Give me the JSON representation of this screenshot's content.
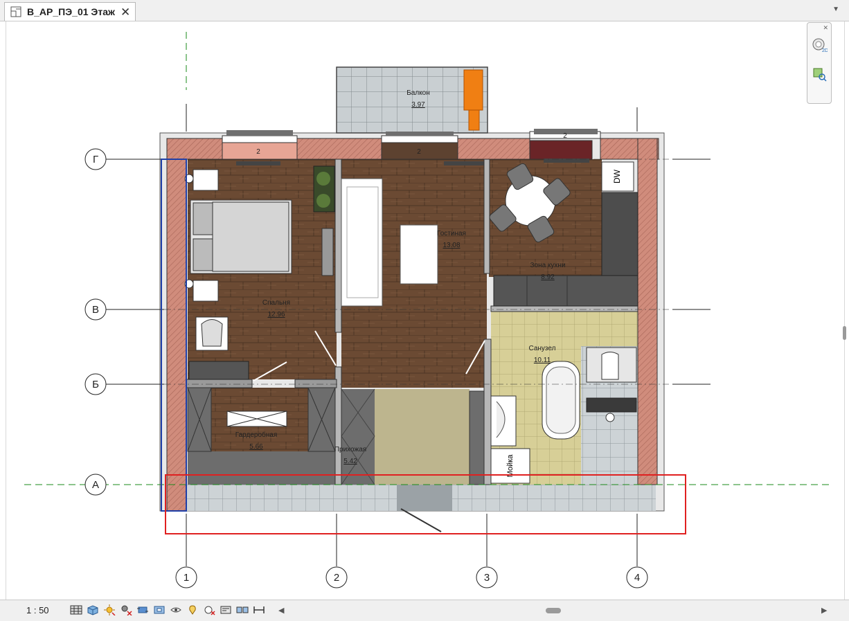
{
  "tab": {
    "title": "В_АР_ПЭ_01 Этаж",
    "close": "✕",
    "dropdown": "▼"
  },
  "rooms": [
    {
      "name": "Балкон",
      "area": "3.97"
    },
    {
      "name": "Гостиная",
      "area": "13.08"
    },
    {
      "name": "Зона кухни",
      "area": "8.92"
    },
    {
      "name": "Спальня",
      "area": "12.96"
    },
    {
      "name": "Санузел",
      "area": "10.11"
    },
    {
      "name": "Гардеробная",
      "area": "5.66"
    },
    {
      "name": "Прихожая",
      "area": "5.42"
    }
  ],
  "labels": {
    "dishwasher": "DW",
    "sink": "Мойка",
    "window_tag": "2"
  },
  "grid": {
    "rows": [
      "Г",
      "В",
      "Б",
      "А"
    ],
    "cols": [
      "1",
      "2",
      "3",
      "4"
    ]
  },
  "statusbar": {
    "scale": "1 : 50",
    "icons": [
      "detail-level-icon",
      "visual-style-icon",
      "sun-path-icon",
      "shadows-icon",
      "crop-view-icon",
      "show-crop-icon",
      "unlock-3d-icon",
      "temporary-hide-icon",
      "reveal-hidden-icon",
      "temporary-properties-icon",
      "worksharing-icon",
      "analytical-model-icon"
    ],
    "scroll_left": "◀",
    "scroll_right": "▶"
  },
  "colors": {
    "wood": "#6b4a33",
    "brick": "#d08c7c",
    "tile_bath": "#d7cf97",
    "tile_gray": "#cdd3d6",
    "selection": "#e02020",
    "hall": "#bdb58e"
  }
}
